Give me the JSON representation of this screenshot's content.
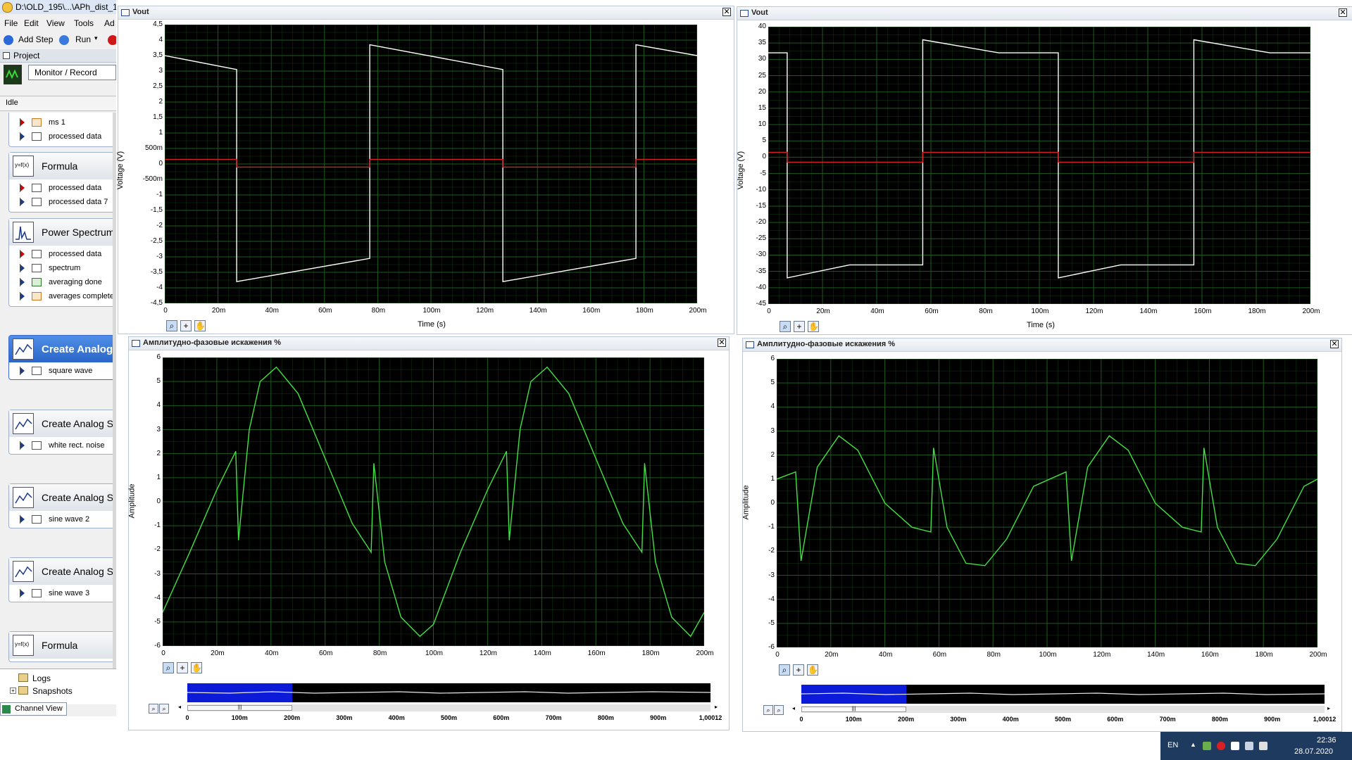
{
  "app": {
    "title": "D:\\OLD_195\\...\\APh_dist_1",
    "menu": [
      "File",
      "Edit",
      "View",
      "Tools",
      "Ad"
    ],
    "toolbar": {
      "add_step": "Add Step",
      "run": "Run"
    },
    "project_label": "Project",
    "monitor_dropdown": "Monitor / Record",
    "status": "Idle"
  },
  "steps": [
    {
      "title": "",
      "rows": [
        {
          "label": "ms 1",
          "dir": "out",
          "icon": "dbl-icon"
        },
        {
          "label": "processed data",
          "dir": "in",
          "icon": "waveform-icon"
        }
      ]
    },
    {
      "title": "Formula",
      "icon": "formula-icon",
      "rows": [
        {
          "label": "processed data",
          "dir": "out",
          "icon": "waveform-icon"
        },
        {
          "label": "processed data 7",
          "dir": "in",
          "icon": "waveform-icon"
        }
      ]
    },
    {
      "title": "Power Spectrum",
      "icon": "spectrum-icon",
      "rows": [
        {
          "label": "processed data",
          "dir": "out",
          "icon": "waveform-icon"
        },
        {
          "label": "spectrum",
          "dir": "in",
          "icon": "spectrum-icon"
        },
        {
          "label": "averaging done",
          "dir": "in",
          "icon": "bool-icon"
        },
        {
          "label": "averages completed",
          "dir": "in",
          "icon": "dbl-icon"
        }
      ]
    },
    {
      "title": "Create Analog",
      "icon": "signal-icon",
      "selected": true,
      "rows": [
        {
          "label": "square wave",
          "dir": "in",
          "icon": "waveform-icon"
        }
      ]
    },
    {
      "title": "Create Analog Si",
      "icon": "signal-icon",
      "rows": [
        {
          "label": "white rect. noise",
          "dir": "in",
          "icon": "waveform-icon"
        }
      ]
    },
    {
      "title": "Create Analog Si",
      "icon": "signal-icon",
      "rows": [
        {
          "label": "sine wave 2",
          "dir": "in",
          "icon": "waveform-icon"
        }
      ]
    },
    {
      "title": "Create Analog Si",
      "icon": "signal-icon",
      "rows": [
        {
          "label": "sine wave 3",
          "dir": "in",
          "icon": "waveform-icon"
        }
      ]
    },
    {
      "title": "Formula",
      "icon": "formula-icon",
      "rows": []
    }
  ],
  "tree": {
    "logs": "Logs",
    "snapshots": "Snapshots",
    "channel_view": "Channel View"
  },
  "colors": {
    "trace_white": "#ffffff",
    "trace_red": "#d42020",
    "trace_green": "#44e044",
    "grid": "#1e5a1e",
    "selection_blue": "#0b1bd8"
  },
  "panels": {
    "vout_left": {
      "title": "Vout",
      "xlabel": "Time (s)",
      "ylabel": "Voltage (V)",
      "yticks": [
        "4,5",
        "4",
        "3,5",
        "3",
        "2,5",
        "2",
        "1,5",
        "1",
        "500m",
        "0",
        "-500m",
        "-1",
        "-1,5",
        "-2",
        "-2,5",
        "-3",
        "-3,5",
        "-4",
        "-4,5"
      ],
      "xticks": [
        "0",
        "20m",
        "40m",
        "60m",
        "80m",
        "100m",
        "120m",
        "140m",
        "160m",
        "180m",
        "200m"
      ]
    },
    "vout_right": {
      "title": "Vout",
      "xlabel": "Time (s)",
      "ylabel": "Voltage (V)",
      "yticks": [
        "40",
        "35",
        "30",
        "25",
        "20",
        "15",
        "10",
        "5",
        "0",
        "-5",
        "-10",
        "-15",
        "-20",
        "-25",
        "-30",
        "-35",
        "-40",
        "-45"
      ],
      "xticks": [
        "0",
        "20m",
        "40m",
        "60m",
        "80m",
        "100m",
        "120m",
        "140m",
        "160m",
        "180m",
        "200m"
      ]
    },
    "dist_left": {
      "title": "Амплитудно-фазовые искажения %",
      "ylabel": "Amplitude",
      "yticks": [
        "6",
        "5",
        "4",
        "3",
        "2",
        "1",
        "0",
        "-1",
        "-2",
        "-3",
        "-4",
        "-5",
        "-6"
      ],
      "xticks": [
        "0",
        "20m",
        "40m",
        "60m",
        "80m",
        "100m",
        "120m",
        "140m",
        "160m",
        "180m",
        "200m"
      ],
      "nav_ticks": [
        "0",
        "100m",
        "200m",
        "300m",
        "400m",
        "500m",
        "600m",
        "700m",
        "800m",
        "900m",
        "1,00012"
      ]
    },
    "dist_right": {
      "title": "Амплитудно-фазовые искажения %",
      "ylabel": "Amplitude",
      "yticks": [
        "6",
        "5",
        "4",
        "3",
        "2",
        "1",
        "0",
        "-1",
        "-2",
        "-3",
        "-4",
        "-5",
        "-6"
      ],
      "xticks": [
        "0",
        "20m",
        "40m",
        "60m",
        "80m",
        "100m",
        "120m",
        "140m",
        "160m",
        "180m",
        "200m"
      ],
      "nav_ticks": [
        "0",
        "100m",
        "200m",
        "300m",
        "400m",
        "500m",
        "600m",
        "700m",
        "800m",
        "900m",
        "1,00012"
      ]
    }
  },
  "chart_data": [
    {
      "type": "line",
      "title": "Vout",
      "xlabel": "Time (s)",
      "ylabel": "Voltage (V)",
      "xlim": [
        0,
        0.2
      ],
      "ylim": [
        -4.5,
        4.5
      ],
      "grid": true,
      "series": [
        {
          "color": "#ffffff",
          "x": [
            0,
            0.027,
            0.027,
            0.077,
            0.077,
            0.127,
            0.127,
            0.177,
            0.177,
            0.2
          ],
          "y": [
            3.5,
            3.05,
            -3.8,
            -3.05,
            3.85,
            3.05,
            -3.8,
            -3.05,
            3.85,
            3.5
          ]
        },
        {
          "color": "#d42020",
          "x": [
            0,
            0.027,
            0.027,
            0.077,
            0.077,
            0.127,
            0.127,
            0.177,
            0.177,
            0.2
          ],
          "y": [
            0.15,
            0.15,
            -0.1,
            -0.1,
            0.15,
            0.15,
            -0.1,
            -0.1,
            0.15,
            0.15
          ]
        }
      ]
    },
    {
      "type": "line",
      "title": "Vout",
      "xlabel": "Time (s)",
      "ylabel": "Voltage (V)",
      "xlim": [
        0,
        0.2
      ],
      "ylim": [
        -45,
        40
      ],
      "grid": true,
      "series": [
        {
          "color": "#ffffff",
          "x": [
            0,
            0.007,
            0.007,
            0.03,
            0.057,
            0.057,
            0.085,
            0.107,
            0.107,
            0.13,
            0.157,
            0.157,
            0.185,
            0.2
          ],
          "y": [
            32,
            32,
            -37,
            -33,
            -33,
            36,
            32,
            32,
            -37,
            -33,
            -33,
            36,
            32,
            32
          ]
        },
        {
          "color": "#d42020",
          "x": [
            0,
            0.007,
            0.007,
            0.057,
            0.057,
            0.107,
            0.107,
            0.157,
            0.157,
            0.2
          ],
          "y": [
            1.5,
            1.5,
            -1.5,
            -1.5,
            1.5,
            1.5,
            -1.5,
            -1.5,
            1.5,
            1.5
          ]
        }
      ]
    },
    {
      "type": "line",
      "title": "Амплитудно-фазовые искажения %",
      "ylabel": "Amplitude",
      "xlim": [
        0,
        0.2
      ],
      "ylim": [
        -6,
        6
      ],
      "grid": true,
      "series": [
        {
          "color": "#44e044",
          "x": [
            0,
            0.01,
            0.02,
            0.027,
            0.028,
            0.032,
            0.036,
            0.042,
            0.05,
            0.06,
            0.07,
            0.077,
            0.078,
            0.082,
            0.088,
            0.095,
            0.1,
            0.11,
            0.12,
            0.127,
            0.128,
            0.132,
            0.136,
            0.142,
            0.15,
            0.16,
            0.17,
            0.177,
            0.178,
            0.182,
            0.188,
            0.195,
            0.2
          ],
          "y": [
            -4.6,
            -2.1,
            0.5,
            2.1,
            -1.6,
            3.0,
            5.0,
            5.6,
            4.5,
            1.8,
            -0.9,
            -2.1,
            1.6,
            -2.5,
            -4.8,
            -5.6,
            -5.1,
            -2.1,
            0.5,
            2.1,
            -1.6,
            3.0,
            5.0,
            5.6,
            4.5,
            1.8,
            -0.9,
            -2.1,
            1.6,
            -2.5,
            -4.8,
            -5.6,
            -4.6
          ]
        }
      ]
    },
    {
      "type": "line",
      "title": "Амплитудно-фазовые искажения %",
      "ylabel": "Amplitude",
      "xlim": [
        0,
        0.2
      ],
      "ylim": [
        -6,
        6
      ],
      "grid": true,
      "series": [
        {
          "color": "#44e044",
          "x": [
            0,
            0.007,
            0.009,
            0.015,
            0.023,
            0.03,
            0.04,
            0.05,
            0.057,
            0.058,
            0.063,
            0.07,
            0.077,
            0.085,
            0.095,
            0.107,
            0.109,
            0.115,
            0.123,
            0.13,
            0.14,
            0.15,
            0.157,
            0.158,
            0.163,
            0.17,
            0.177,
            0.185,
            0.195,
            0.2
          ],
          "y": [
            1.0,
            1.3,
            -2.4,
            1.5,
            2.8,
            2.2,
            0.0,
            -1.0,
            -1.2,
            2.3,
            -1.0,
            -2.5,
            -2.6,
            -1.5,
            0.7,
            1.3,
            -2.4,
            1.5,
            2.8,
            2.2,
            0.0,
            -1.0,
            -1.2,
            2.3,
            -1.0,
            -2.5,
            -2.6,
            -1.5,
            0.7,
            1.0
          ]
        }
      ]
    }
  ],
  "taskbar": {
    "lang": "EN",
    "time": "22:36",
    "date": "28.07.2020"
  }
}
